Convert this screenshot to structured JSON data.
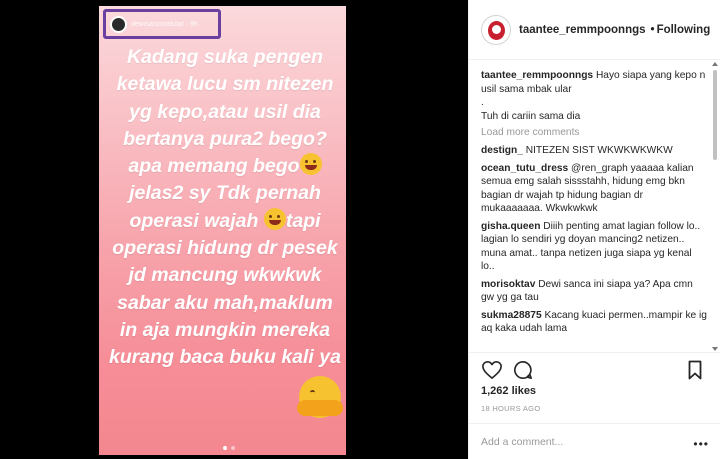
{
  "story": {
    "username": "dewisancoratular · 9h",
    "lines": [
      "Kadang suka pengen",
      "ketawa lucu sm nitezen",
      "yg kepo,atau usil dia",
      "bertanya pura2 bego?",
      "apa memang bego",
      "jelas2 sy Tdk pernah",
      "operasi wajah",
      "tapi",
      "operasi hidung dr pesek",
      "jd mancung wkwkwk",
      "sabar  aku mah,maklum",
      "in aja mungkin  mereka",
      "kurang baca buku kali ya"
    ]
  },
  "post": {
    "username": "taantee_remmpoonngs",
    "separator": "•",
    "follow_label": "Following",
    "caption": {
      "user": "taantee_remmpoonngs",
      "text": "Hayo siapa yang kepo n usil sama mbak ular",
      "line2": ".",
      "line3": "Tuh di cariin sama dia"
    },
    "load_more": "Load more comments",
    "comments": [
      {
        "user": "destign_",
        "text": "NITEZEN SIST WKWKWKWKW"
      },
      {
        "user": "ocean_tutu_dress",
        "text": "@ren_graph yaaaaa kalian semua emg salah sissstahh, hidung emg bkn bagian dr wajah tp hidung bagian dr mukaaaaaaa. Wkwkwkwk"
      },
      {
        "user": "gisha.queen",
        "text": "Diiih penting amat lagian follow lo.. lagian lo sendiri yg doyan mancing2 netizen.. muna amat.. tanpa netizen juga siapa yg kenal lo.."
      },
      {
        "user": "morisoktav",
        "text": "Dewi sanca ini siapa ya? Apa cmn gw yg ga tau"
      },
      {
        "user": "sukma28875",
        "text": "Kacang kuaci permen..mampir ke ig aq kaka udah lama"
      }
    ],
    "likes": "1,262 likes",
    "time": "18 HOURS AGO",
    "add_comment_placeholder": "Add a comment...",
    "more_label": "•••"
  },
  "colors": {
    "story_top": "#fbd9dc",
    "story_bottom": "#f4878f",
    "highlight_border": "#6b3fa0"
  }
}
